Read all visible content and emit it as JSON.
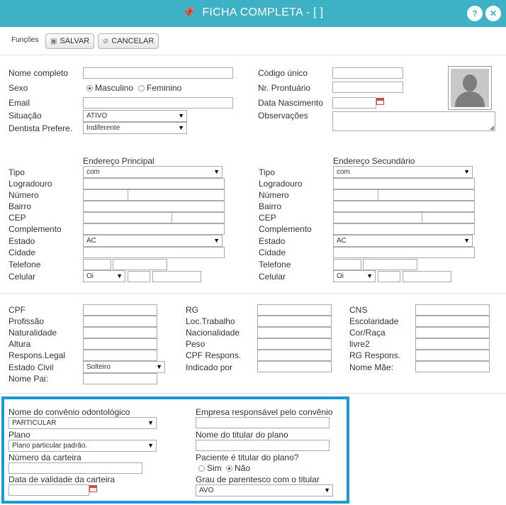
{
  "window": {
    "title": "FICHA COMPLETA - [         ]",
    "pin_icon": "pin-icon",
    "help_icon": "help-icon",
    "close_icon": "close-icon"
  },
  "toolbar": {
    "group_label": "Funções",
    "save_label": "SALVAR",
    "cancel_label": "CANCELAR"
  },
  "personal": {
    "nome_label": "Nome completo",
    "sexo_label": "Sexo",
    "masculino": "Masculino",
    "feminino": "Feminino",
    "email_label": "Email",
    "situacao_label": "Situação",
    "situacao_value": "ATIVO",
    "dentista_label": "Dentista Prefere.",
    "dentista_value": "Indiferente",
    "codigo_label": "Código único",
    "prontuario_label": "Nr. Prontuário",
    "nascimento_label": "Data Nascimento",
    "observacoes_label": "Observações"
  },
  "address": {
    "principal_title": "Endereço Principal",
    "secundario_title": "Endereço Secundário",
    "tipo": "Tipo",
    "logradouro": "Logradouro",
    "numero": "Número",
    "bairro": "Bairro",
    "cep": "CEP",
    "complemento": "Complemento",
    "estado": "Estado",
    "cidade": "Cidade",
    "telefone": "Telefone",
    "celular": "Celular",
    "tipo_value": "com",
    "estado_value": "AC",
    "operadora_value": "Oi"
  },
  "docs": {
    "cpf": "CPF",
    "profissao": "Profissão",
    "naturalidade": "Naturalidade",
    "altura": "Altura",
    "respons_legal": "Respons.Legal",
    "estado_civil": "Estado Civil",
    "estado_civil_value": "Solteiro",
    "nome_pai": "Nome Pai:",
    "rg": "RG",
    "loc_trabalho": "Loc.Trabalho",
    "nacionalidade": "Nacionalidade",
    "peso": "Peso",
    "cpf_respons": "CPF Respons.",
    "indicado_por": "Indicado por",
    "cns": "CNS",
    "escolaridade": "Escolaridade",
    "cor_raca": "Cor/Raça",
    "livre2": "livre2",
    "rg_respons": "RG Respons.",
    "nome_mae": "Nome Mãe:"
  },
  "convenio": {
    "nome_label": "Nome do convênio odontológico",
    "nome_value": "PARTICULAR",
    "plano_label": "Plano",
    "plano_value": "Plano particular padrão.",
    "carteira_label": "Número da carteira",
    "validade_label": "Data de validade da carteira",
    "empresa_label": "Empresa responsável pelo convênio",
    "titular_label": "Nome do titular do plano",
    "paciente_titular_label": "Paciente é titular do plano?",
    "sim": "Sim",
    "nao": "Não",
    "parentesco_label": "Grau de parentesco com o titular",
    "parentesco_value": "AVO"
  }
}
